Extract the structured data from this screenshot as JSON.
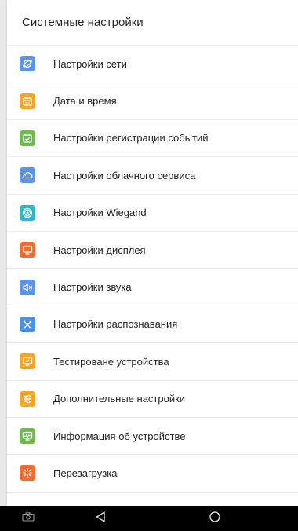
{
  "header": {
    "title": "Системные настройки"
  },
  "menu": {
    "items": [
      {
        "label": "Настройки сети",
        "icon": "network-icon",
        "color": "#5b93e8"
      },
      {
        "label": "Дата и время",
        "icon": "calendar-icon",
        "color": "#f4a623"
      },
      {
        "label": "Настройки регистрации событий",
        "icon": "event-log-icon",
        "color": "#6dbb4e"
      },
      {
        "label": "Настройки облачного сервиса",
        "icon": "cloud-icon",
        "color": "#5b93e8"
      },
      {
        "label": "Настройки Wiegand",
        "icon": "wiegand-icon",
        "color": "#2fb6c9"
      },
      {
        "label": "Настройки дисплея",
        "icon": "display-icon",
        "color": "#f26a2e"
      },
      {
        "label": "Настройки звука",
        "icon": "sound-icon",
        "color": "#5b93e8"
      },
      {
        "label": "Настройки распознавания",
        "icon": "recognition-icon",
        "color": "#4a90e2"
      },
      {
        "label": "Тестироване устройства",
        "icon": "device-test-icon",
        "color": "#f4a623"
      },
      {
        "label": "Дополнительные настройки",
        "icon": "advanced-settings-icon",
        "color": "#f4a623"
      },
      {
        "label": "Информация об устройстве",
        "icon": "device-info-icon",
        "color": "#6dbb4e"
      },
      {
        "label": "Перезагрузка",
        "icon": "reboot-icon",
        "color": "#f26a2e"
      }
    ]
  },
  "navbar": {
    "buttons": [
      {
        "icon": "screenshot-icon"
      },
      {
        "icon": "back-icon"
      },
      {
        "icon": "home-icon"
      }
    ]
  }
}
